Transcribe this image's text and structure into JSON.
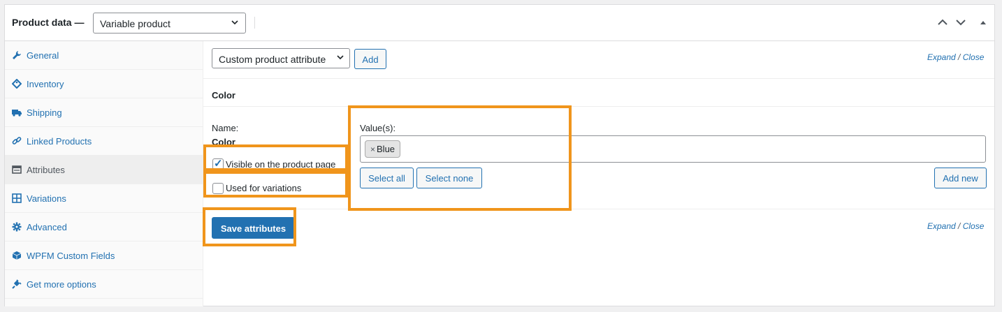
{
  "header": {
    "title": "Product data —",
    "product_type": "Variable product",
    "controls": [
      "chevron-up-icon",
      "chevron-down-icon",
      "collapse-triangle-icon"
    ]
  },
  "sidebar": {
    "items": [
      {
        "label": "General",
        "icon": "wrench-icon",
        "active": false
      },
      {
        "label": "Inventory",
        "icon": "tag-icon",
        "active": false
      },
      {
        "label": "Shipping",
        "icon": "truck-icon",
        "active": false
      },
      {
        "label": "Linked Products",
        "icon": "link-icon",
        "active": false
      },
      {
        "label": "Attributes",
        "icon": "table-icon",
        "active": true
      },
      {
        "label": "Variations",
        "icon": "grid-icon",
        "active": false
      },
      {
        "label": "Advanced",
        "icon": "gear-icon",
        "active": false
      },
      {
        "label": "WPFM Custom Fields",
        "icon": "cube-icon",
        "active": false
      },
      {
        "label": "Get more options",
        "icon": "plugin-icon",
        "active": false
      }
    ]
  },
  "attributes": {
    "attribute_select": "Custom product attribute",
    "add_label": "Add",
    "expand_label": "Expand",
    "slash": " / ",
    "close_label": "Close",
    "heading": "Color",
    "name_label": "Name:",
    "name_value": "Color",
    "visible_label": "Visible on the product page",
    "visible_checked": true,
    "variations_label": "Used for variations",
    "variations_checked": false,
    "values_label": "Value(s):",
    "value_chips": [
      {
        "remove": "×",
        "text": "Blue"
      }
    ],
    "select_all_label": "Select all",
    "select_none_label": "Select none",
    "add_new_label": "Add new",
    "save_label": "Save attributes"
  },
  "colors": {
    "accent": "#2271b1",
    "highlight": "#f0951c",
    "active_tab_bg": "#eeeeee"
  }
}
